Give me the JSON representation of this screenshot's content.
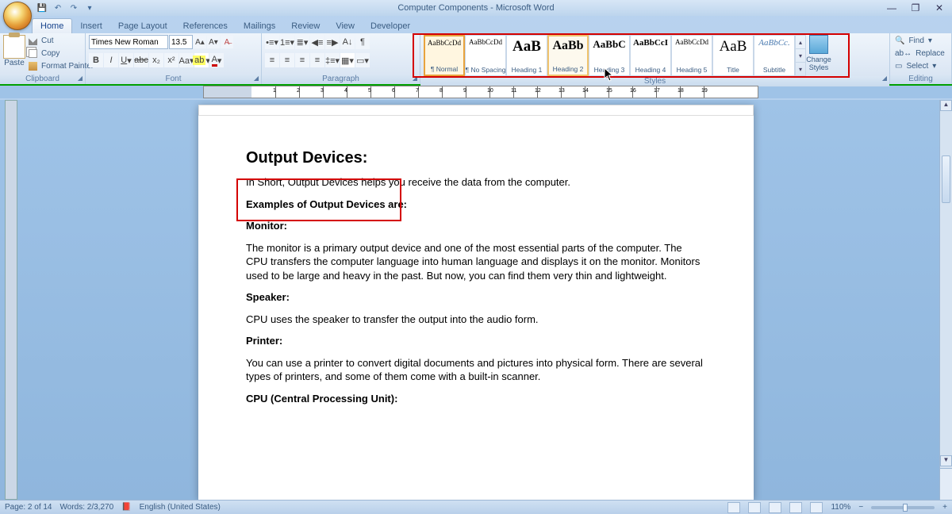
{
  "app": {
    "title": "Computer Components - Microsoft Word"
  },
  "window_controls": {
    "min": "—",
    "max": "❐",
    "close": "✕"
  },
  "qat": {
    "save": "💾",
    "undo": "↶",
    "redo": "↷",
    "more": "▾"
  },
  "tabs": [
    "Home",
    "Insert",
    "Page Layout",
    "References",
    "Mailings",
    "Review",
    "View",
    "Developer"
  ],
  "active_tab": "Home",
  "clipboard": {
    "label": "Clipboard",
    "paste": "Paste",
    "cut": "Cut",
    "copy": "Copy",
    "format_painter": "Format Painter"
  },
  "font": {
    "label": "Font",
    "name": "Times New Roman",
    "size": "13.5"
  },
  "paragraph": {
    "label": "Paragraph"
  },
  "styles": {
    "label": "Styles",
    "change_styles": "Change Styles",
    "items": [
      {
        "preview": "AaBbCcDd",
        "name": "¶ Normal",
        "psize": "9px"
      },
      {
        "preview": "AaBbCcDd",
        "name": "¶ No Spacing",
        "psize": "9px"
      },
      {
        "preview": "AaB",
        "name": "Heading 1",
        "psize": "19px",
        "bold": true
      },
      {
        "preview": "AaBb",
        "name": "Heading 2",
        "psize": "16px",
        "bold": true
      },
      {
        "preview": "AaBbC",
        "name": "Heading 3",
        "psize": "13px",
        "bold": true
      },
      {
        "preview": "AaBbCcI",
        "name": "Heading 4",
        "psize": "11px",
        "bold": true
      },
      {
        "preview": "AaBbCcDd",
        "name": "Heading 5",
        "psize": "9px"
      },
      {
        "preview": "AaB",
        "name": "Title",
        "psize": "19px"
      },
      {
        "preview": "AaBbCc.",
        "name": "Subtitle",
        "psize": "11px",
        "italic": true,
        "color": "#4a7ab0"
      }
    ]
  },
  "editing": {
    "label": "Editing",
    "find": "Find",
    "replace": "Replace",
    "select": "Select"
  },
  "document": {
    "heading": "Output Devices:",
    "p1": "In Short, Output Devices helps you receive the data from the computer.",
    "p2": "Examples of Output Devices are:",
    "p3": "Monitor:",
    "p4": "The monitor is a primary output device and one of the most essential parts of the computer. The CPU transfers the computer language into human language and displays it on the monitor. Monitors used to be large and heavy in the past. But now, you can find them very thin and lightweight.",
    "p5": "Speaker:",
    "p6": "CPU uses the speaker to transfer the output into the audio form.",
    "p7": "Printer:",
    "p8": "You can use a printer to convert digital documents and pictures into physical form. There are several types of printers, and some of them come with a built-in scanner.",
    "p9": "CPU (Central Processing Unit):"
  },
  "status": {
    "page": "Page: 2 of 14",
    "words": "Words: 2/3,270",
    "lang": "English (United States)",
    "zoom": "110%"
  }
}
